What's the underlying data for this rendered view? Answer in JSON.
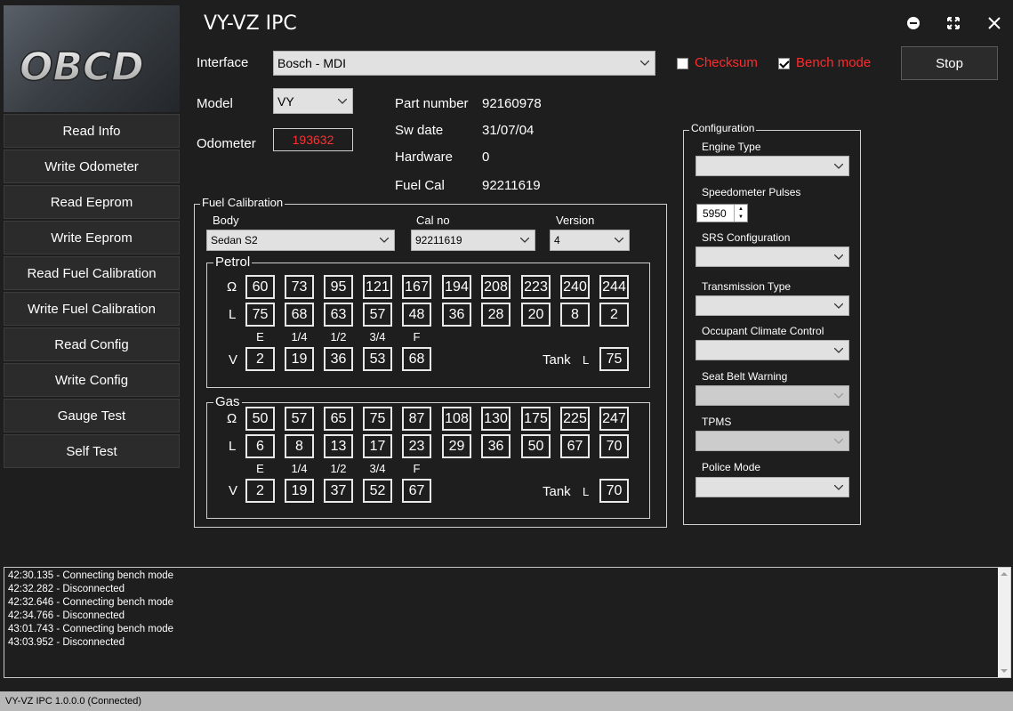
{
  "app": {
    "title": "VY-VZ IPC",
    "logo_text": "OBCD"
  },
  "sidebar": {
    "items": [
      {
        "label": "Read Info"
      },
      {
        "label": "Write Odometer"
      },
      {
        "label": "Read Eeprom"
      },
      {
        "label": "Write Eeprom"
      },
      {
        "label": "Read Fuel Calibration"
      },
      {
        "label": "Write Fuel Calibration"
      },
      {
        "label": "Read Config"
      },
      {
        "label": "Write Config"
      },
      {
        "label": "Gauge Test"
      },
      {
        "label": "Self Test"
      }
    ]
  },
  "header": {
    "interface_label": "Interface",
    "interface_value": "Bosch - MDI",
    "checksum_label": "Checksum",
    "checksum_checked": false,
    "bench_label": "Bench mode",
    "bench_checked": true,
    "stop_label": "Stop",
    "accent_color": "#ff2a2a"
  },
  "info": {
    "model_label": "Model",
    "model_value": "VY",
    "odometer_label": "Odometer",
    "odometer_value": "193632",
    "part_number_label": "Part number",
    "part_number_value": "92160978",
    "sw_date_label": "Sw date",
    "sw_date_value": "31/07/04",
    "hardware_label": "Hardware",
    "hardware_value": "0",
    "fuel_cal_label": "Fuel Cal",
    "fuel_cal_value": "92211619"
  },
  "fuel": {
    "legend": "Fuel Calibration",
    "body_label": "Body",
    "body_value": "Sedan S2",
    "calno_label": "Cal no",
    "calno_value": "92211619",
    "version_label": "Version",
    "version_value": "4",
    "ohm_symbol": "Ω",
    "l_symbol": "L",
    "v_symbol": "V",
    "tank_label": "Tank",
    "tank_l": "L",
    "marks": [
      "E",
      "1/4",
      "1/2",
      "3/4",
      "F"
    ],
    "petrol": {
      "legend": "Petrol",
      "ohm": [
        "60",
        "73",
        "95",
        "121",
        "167",
        "194",
        "208",
        "223",
        "240",
        "244"
      ],
      "litres": [
        "75",
        "68",
        "63",
        "57",
        "48",
        "36",
        "28",
        "20",
        "8",
        "2"
      ],
      "volts": [
        "2",
        "19",
        "36",
        "53",
        "68"
      ],
      "tank": "75"
    },
    "gas": {
      "legend": "Gas",
      "ohm": [
        "50",
        "57",
        "65",
        "75",
        "87",
        "108",
        "130",
        "175",
        "225",
        "247"
      ],
      "litres": [
        "6",
        "8",
        "13",
        "17",
        "23",
        "29",
        "36",
        "50",
        "67",
        "70"
      ],
      "volts": [
        "2",
        "19",
        "37",
        "52",
        "67"
      ],
      "tank": "70"
    }
  },
  "config": {
    "legend": "Configuration",
    "engine_type": "Engine Type",
    "speedo_pulses": "Speedometer Pulses",
    "speedo_value": "5950",
    "srs": "SRS Configuration",
    "transmission": "Transmission Type",
    "climate": "Occupant Climate Control",
    "seat_belt": "Seat Belt Warning",
    "tpms": "TPMS",
    "police": "Police Mode"
  },
  "log": {
    "lines": [
      "42:30.135 - Connecting bench mode",
      "42:32.282 - Disconnected",
      "42:32.646 - Connecting bench mode",
      "42:34.766 - Disconnected",
      "43:01.743 - Connecting bench mode",
      "43:03.952 - Disconnected"
    ]
  },
  "status": {
    "text": "VY-VZ IPC 1.0.0.0 (Connected)"
  }
}
